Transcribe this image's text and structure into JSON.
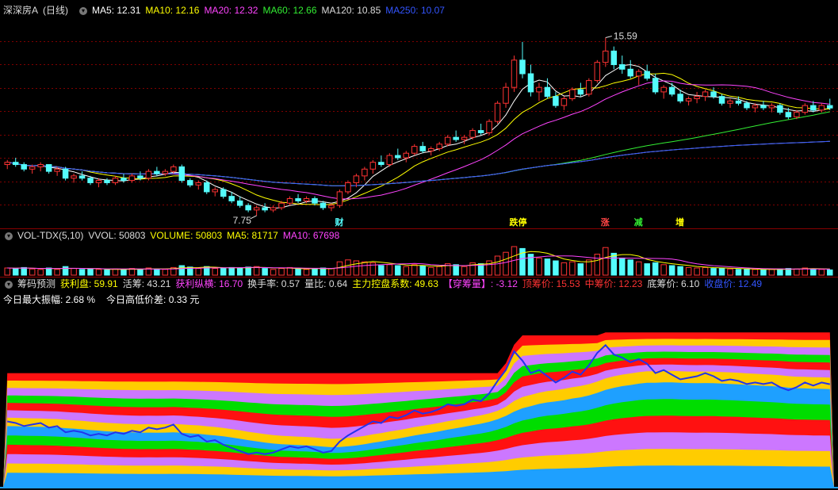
{
  "title": {
    "stock": "深深房A",
    "period": "(日线)"
  },
  "ma_legend": [
    {
      "label": "MA5: 12.31",
      "color": "#ffffff"
    },
    {
      "label": "MA10: 12.16",
      "color": "#ffff00"
    },
    {
      "label": "MA20: 12.32",
      "color": "#ff44ff"
    },
    {
      "label": "MA60: 12.66",
      "color": "#33ee33"
    },
    {
      "label": "MA120: 10.85",
      "color": "#dddddd"
    },
    {
      "label": "MA250: 10.07",
      "color": "#3355ff"
    }
  ],
  "vol_legend": [
    {
      "label": "VOL-TDX(5,10)",
      "color": "#dddddd"
    },
    {
      "label": "VVOL: 50803",
      "color": "#dddddd"
    },
    {
      "label": "VOLUME: 50803",
      "color": "#ffff00"
    },
    {
      "label": "MA5: 81717",
      "color": "#ffff00"
    },
    {
      "label": "MA10: 67698",
      "color": "#ff44ff"
    }
  ],
  "chip_legend": [
    {
      "label": "筹码预测",
      "color": "#dddddd"
    },
    {
      "label": "获利盘: 59.91",
      "color": "#ffff00"
    },
    {
      "label": "活筹: 43.21",
      "color": "#dddddd"
    },
    {
      "label": "获利纵横: 16.70",
      "color": "#ff44ff"
    },
    {
      "label": "换手率: 0.57",
      "color": "#dddddd"
    },
    {
      "label": "量比: 0.64",
      "color": "#dddddd"
    },
    {
      "label": "主力控盘系数: 49.63",
      "color": "#ffff00"
    },
    {
      "label": "【穿筹量】: -3.12",
      "color": "#ff44ff"
    },
    {
      "label": "顶筹价: 15.53",
      "color": "#ff3333"
    },
    {
      "label": "中筹价: 12.23",
      "color": "#ff3333"
    },
    {
      "label": "底筹价: 6.10",
      "color": "#dddddd"
    },
    {
      "label": "收盘价: 12.49",
      "color": "#3355ff"
    }
  ],
  "chip_info": {
    "amplitude": "今日最大振幅: 2.68 %",
    "hilo": "今日高低价差: 0.33 元"
  },
  "colors": {
    "up": "#ff3333",
    "down": "#54fcfc",
    "bg": "#000000",
    "grid": "#800000"
  },
  "chart_data": {
    "type": "candlestick",
    "y_high_label": "15.59",
    "y_low_label": "7.75",
    "price_range": [
      7.4,
      16.2
    ],
    "events": [
      {
        "index": 40,
        "label": "财",
        "color": "#54fcfc"
      },
      {
        "index": 61,
        "label": "跌停",
        "color": "#ffff00"
      },
      {
        "index": 72,
        "label": "涨",
        "color": "#ff4444"
      },
      {
        "index": 76,
        "label": "减",
        "color": "#33ee33"
      },
      {
        "index": 81,
        "label": "增",
        "color": "#ffff00"
      }
    ],
    "candles": [
      [
        10.0,
        10.2,
        9.8,
        10.1,
        15
      ],
      [
        10.1,
        10.3,
        9.9,
        10.0,
        14
      ],
      [
        10.0,
        10.1,
        9.7,
        9.8,
        16
      ],
      [
        9.8,
        10.0,
        9.6,
        9.9,
        13
      ],
      [
        9.9,
        10.1,
        9.7,
        10.0,
        12
      ],
      [
        10.0,
        10.0,
        9.6,
        9.7,
        15
      ],
      [
        9.7,
        9.9,
        9.5,
        9.8,
        12
      ],
      [
        9.8,
        9.9,
        9.3,
        9.4,
        18
      ],
      [
        9.4,
        9.6,
        9.2,
        9.5,
        14
      ],
      [
        9.5,
        9.7,
        9.3,
        9.4,
        12
      ],
      [
        9.4,
        9.5,
        9.1,
        9.2,
        13
      ],
      [
        9.2,
        9.4,
        9.0,
        9.3,
        12
      ],
      [
        9.3,
        9.4,
        9.1,
        9.2,
        11
      ],
      [
        9.2,
        9.5,
        9.1,
        9.4,
        13
      ],
      [
        9.4,
        9.6,
        9.2,
        9.3,
        12
      ],
      [
        9.3,
        9.6,
        9.2,
        9.5,
        14
      ],
      [
        9.5,
        9.7,
        9.3,
        9.4,
        12
      ],
      [
        9.4,
        9.8,
        9.3,
        9.7,
        15
      ],
      [
        9.7,
        9.9,
        9.5,
        9.6,
        13
      ],
      [
        9.6,
        9.8,
        9.5,
        9.7,
        12
      ],
      [
        9.7,
        10.0,
        9.6,
        9.9,
        16
      ],
      [
        9.9,
        10.0,
        9.2,
        9.3,
        20
      ],
      [
        9.3,
        9.4,
        9.0,
        9.1,
        17
      ],
      [
        9.1,
        9.3,
        8.9,
        9.2,
        14
      ],
      [
        9.2,
        9.3,
        8.7,
        8.8,
        18
      ],
      [
        8.8,
        9.0,
        8.6,
        8.9,
        14
      ],
      [
        8.9,
        9.0,
        8.5,
        8.6,
        15
      ],
      [
        8.6,
        8.8,
        8.3,
        8.4,
        16
      ],
      [
        8.4,
        8.6,
        8.1,
        8.2,
        15
      ],
      [
        8.2,
        8.3,
        7.9,
        8.0,
        17
      ],
      [
        8.0,
        8.2,
        7.75,
        8.1,
        18
      ],
      [
        8.1,
        8.3,
        7.9,
        8.0,
        14
      ],
      [
        8.0,
        8.2,
        7.9,
        8.1,
        12
      ],
      [
        8.1,
        8.4,
        8.0,
        8.3,
        14
      ],
      [
        8.3,
        8.6,
        8.2,
        8.5,
        16
      ],
      [
        8.5,
        8.7,
        8.3,
        8.4,
        13
      ],
      [
        8.4,
        8.6,
        8.3,
        8.5,
        12
      ],
      [
        8.5,
        8.6,
        8.2,
        8.3,
        13
      ],
      [
        8.3,
        8.4,
        8.0,
        8.1,
        15
      ],
      [
        8.1,
        8.3,
        7.95,
        8.2,
        14
      ],
      [
        8.2,
        8.9,
        8.1,
        8.8,
        28
      ],
      [
        8.8,
        9.3,
        8.7,
        9.2,
        32
      ],
      [
        9.2,
        9.6,
        9.0,
        9.5,
        30
      ],
      [
        9.5,
        9.9,
        9.3,
        9.8,
        28
      ],
      [
        9.8,
        10.2,
        9.6,
        10.1,
        26
      ],
      [
        10.1,
        10.4,
        9.9,
        10.0,
        20
      ],
      [
        10.0,
        10.5,
        9.9,
        10.4,
        22
      ],
      [
        10.4,
        10.7,
        10.2,
        10.3,
        20
      ],
      [
        10.3,
        10.6,
        10.1,
        10.5,
        18
      ],
      [
        10.5,
        10.9,
        10.4,
        10.8,
        22
      ],
      [
        10.8,
        11.0,
        10.5,
        10.6,
        20
      ],
      [
        10.6,
        10.8,
        10.4,
        10.7,
        16
      ],
      [
        10.7,
        11.0,
        10.6,
        10.9,
        18
      ],
      [
        10.9,
        11.3,
        10.8,
        11.2,
        24
      ],
      [
        11.2,
        11.5,
        11.0,
        11.1,
        22
      ],
      [
        11.1,
        11.3,
        10.9,
        11.2,
        18
      ],
      [
        11.2,
        11.6,
        11.1,
        11.5,
        26
      ],
      [
        11.5,
        11.8,
        11.3,
        11.4,
        24
      ],
      [
        11.4,
        12.0,
        11.3,
        11.9,
        30
      ],
      [
        11.9,
        12.8,
        11.8,
        12.7,
        40
      ],
      [
        12.7,
        13.6,
        12.5,
        13.4,
        48
      ],
      [
        13.4,
        14.8,
        13.2,
        14.6,
        60
      ],
      [
        14.6,
        15.4,
        13.8,
        14.0,
        56
      ],
      [
        14.0,
        14.4,
        13.0,
        13.2,
        44
      ],
      [
        13.2,
        13.6,
        12.8,
        13.4,
        36
      ],
      [
        13.4,
        13.8,
        12.9,
        13.0,
        34
      ],
      [
        13.0,
        13.2,
        12.5,
        12.6,
        30
      ],
      [
        12.6,
        13.0,
        12.4,
        12.9,
        26
      ],
      [
        12.9,
        13.4,
        12.8,
        13.3,
        28
      ],
      [
        13.3,
        13.6,
        13.0,
        13.1,
        24
      ],
      [
        13.1,
        13.8,
        13.0,
        13.7,
        32
      ],
      [
        13.7,
        14.6,
        13.6,
        14.5,
        44
      ],
      [
        14.5,
        15.59,
        14.3,
        15.0,
        58
      ],
      [
        15.0,
        15.2,
        14.2,
        14.4,
        46
      ],
      [
        14.4,
        14.8,
        14.0,
        14.2,
        36
      ],
      [
        14.2,
        14.6,
        13.8,
        13.9,
        32
      ],
      [
        13.9,
        14.2,
        13.5,
        14.1,
        28
      ],
      [
        14.1,
        14.4,
        13.7,
        13.8,
        24
      ],
      [
        13.8,
        14.0,
        13.1,
        13.2,
        26
      ],
      [
        13.2,
        13.5,
        12.9,
        13.4,
        22
      ],
      [
        13.4,
        13.6,
        13.0,
        13.1,
        20
      ],
      [
        13.1,
        13.3,
        12.7,
        12.8,
        18
      ],
      [
        12.8,
        13.0,
        12.6,
        12.9,
        16
      ],
      [
        12.9,
        13.2,
        12.7,
        13.0,
        15
      ],
      [
        13.0,
        13.3,
        12.8,
        13.2,
        16
      ],
      [
        13.2,
        13.4,
        12.9,
        13.0,
        14
      ],
      [
        13.0,
        13.1,
        12.6,
        12.7,
        15
      ],
      [
        12.7,
        12.9,
        12.5,
        12.8,
        13
      ],
      [
        12.8,
        13.0,
        12.6,
        12.7,
        12
      ],
      [
        12.7,
        12.8,
        12.4,
        12.5,
        13
      ],
      [
        12.5,
        12.7,
        12.3,
        12.6,
        12
      ],
      [
        12.6,
        12.8,
        12.4,
        12.5,
        11
      ],
      [
        12.5,
        12.7,
        12.3,
        12.6,
        12
      ],
      [
        12.6,
        12.7,
        12.2,
        12.3,
        13
      ],
      [
        12.3,
        12.5,
        12.0,
        12.1,
        14
      ],
      [
        12.1,
        12.4,
        12.0,
        12.3,
        13
      ],
      [
        12.3,
        12.7,
        12.2,
        12.6,
        15
      ],
      [
        12.6,
        12.8,
        12.3,
        12.4,
        13
      ],
      [
        12.4,
        12.7,
        12.3,
        12.6,
        12
      ],
      [
        12.6,
        12.9,
        12.4,
        12.49,
        11
      ]
    ]
  }
}
